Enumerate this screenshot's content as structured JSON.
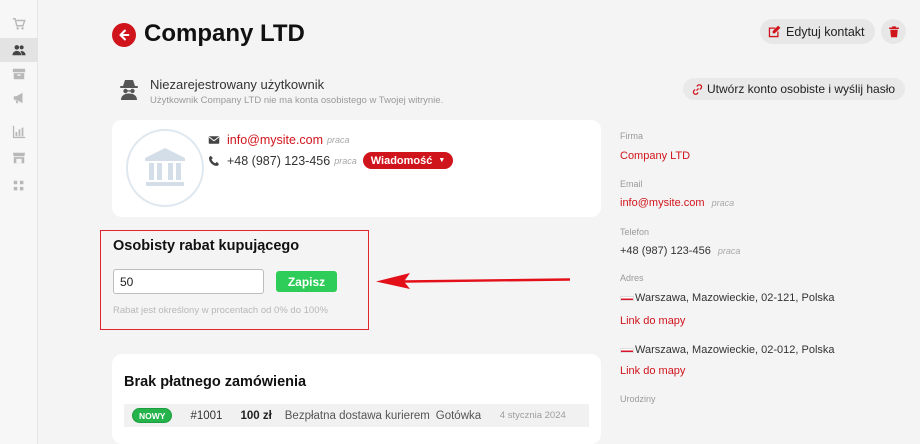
{
  "sidebar": {
    "items": [
      {
        "name": "sidebar-item-cart",
        "icon": "cart-icon",
        "active": false
      },
      {
        "name": "sidebar-item-users",
        "icon": "users-icon",
        "active": true
      },
      {
        "name": "sidebar-item-archive",
        "icon": "archive-icon",
        "active": false
      },
      {
        "name": "sidebar-item-marketing",
        "icon": "megaphone-icon",
        "active": false
      },
      {
        "name": "sidebar-item-stats",
        "icon": "bar-chart-icon",
        "active": false
      },
      {
        "name": "sidebar-item-store",
        "icon": "store-icon",
        "active": false
      },
      {
        "name": "sidebar-item-apps",
        "icon": "apps-icon",
        "active": false
      }
    ]
  },
  "header": {
    "title": "Company LTD",
    "edit_label": "Edytuj kontakt"
  },
  "account": {
    "status_title": "Niezarejestrowany użytkownik",
    "status_subtitle": "Użytkownik Company LTD nie ma konta osobistego w Twojej witrynie.",
    "create_label": "Utwórz konto osobiste i wyślij hasło"
  },
  "contact": {
    "email": "info@mysite.com",
    "email_tag": "praca",
    "phone": "+48 (987) 123-456",
    "phone_tag": "praca",
    "message_label": "Wiadomość"
  },
  "discount": {
    "title": "Osobisty rabat kupującego",
    "value": "50",
    "save_label": "Zapisz",
    "hint": "Rabat jest określony w procentach od 0% do 100%"
  },
  "orders": {
    "title": "Brak płatnego zamówienia",
    "rows": [
      {
        "badge": "NOWY",
        "number": "#1001",
        "price": "100 zł",
        "shipping": "Bezpłatna dostawa kurierem",
        "payment": "Gotówka",
        "date": "4 stycznia 2024"
      }
    ]
  },
  "info": {
    "company_label": "Firma",
    "company_value": "Company LTD",
    "email_label": "Email",
    "email_value": "info@mysite.com",
    "email_tag": "praca",
    "phone_label": "Telefon",
    "phone_value": "+48 (987) 123-456",
    "phone_tag": "praca",
    "address_label": "Adres",
    "address1": "Warszawa, Mazowieckie, 02-121, Polska",
    "map_link1": "Link do mapy",
    "address2": "Warszawa, Mazowieckie, 02-012, Polska",
    "map_link2": "Link do mapy",
    "birthday_label": "Urodziny"
  },
  "colors": {
    "accent": "#d0141c",
    "save_green": "#2ecc58",
    "badge_green": "#25b34b",
    "highlight_border": "#e0242c"
  }
}
